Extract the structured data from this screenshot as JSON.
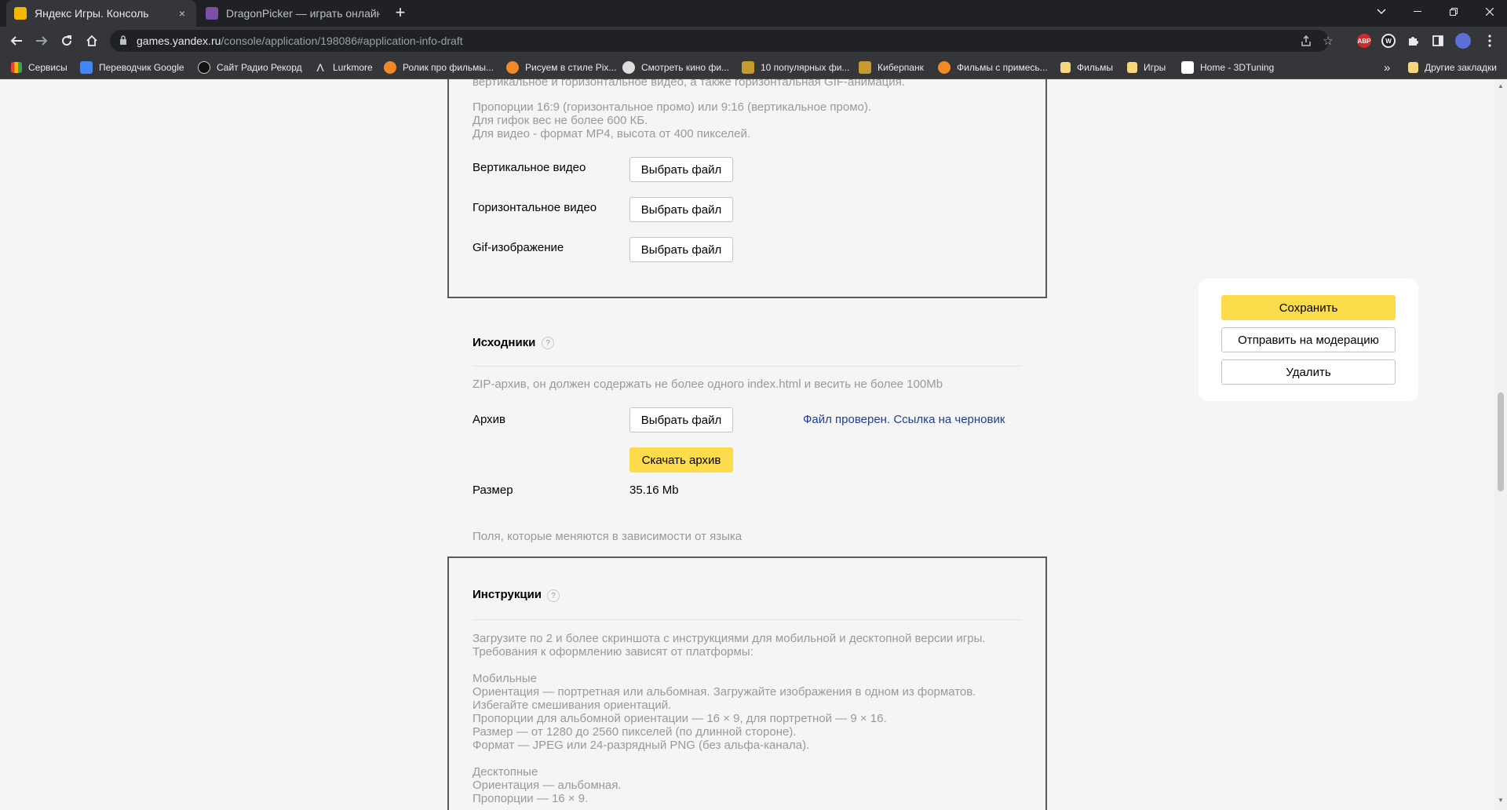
{
  "browser": {
    "tabs": [
      {
        "title": "Яндекс Игры. Консоль",
        "close": "×"
      },
      {
        "title": "DragonPicker — играть онлайн"
      }
    ],
    "new_tab": "+",
    "url_host": "games.yandex.ru",
    "url_path": "/console/application/198086#application-info-draft",
    "extensions": [
      "ABP",
      "W"
    ],
    "bookmarks": [
      "Сервисы",
      "Переводчик Google",
      "Сайт Радио Рекорд",
      "Lurkmore",
      "Ролик про фильмы...",
      "Рисуем в стиле Pix...",
      "Смотреть кино фи...",
      "10 популярных фи...",
      "Киберпанк",
      "Фильмы с примесь...",
      "Фильмы",
      "Игры",
      "Home - 3DTuning"
    ],
    "bookmarks_more": "»",
    "other_bookmarks": "Другие закладки"
  },
  "promo": {
    "cut_line": "вертикальное и горизонтальное видео, а также горизонтальная GIF-анимация.",
    "req1": "Пропорции 16:9 (горизонтальное промо) или 9:16 (вертикальное промо).",
    "req2": "Для гифок вес не более 600 КБ.",
    "req3": "Для видео - формат MP4, высота от 400 пикселей.",
    "vertical_video_label": "Вертикальное видео",
    "horizontal_video_label": "Горизонтальное видео",
    "gif_label": "Gif-изображение",
    "choose_file": "Выбрать файл"
  },
  "sources": {
    "title": "Исходники",
    "help": "?",
    "description": "ZIP-архив, он должен содержать не более одного index.html и весить не более 100Mb",
    "archive_label": "Архив",
    "choose_file": "Выбрать файл",
    "status_text": "Файл проверен.",
    "draft_link": "Ссылка на черновик",
    "download_button": "Скачать архив",
    "size_label": "Размер",
    "size_value": "35.16 Mb",
    "language_note": "Поля, которые меняются в зависимости от языка"
  },
  "instructions": {
    "title": "Инструкции",
    "help": "?",
    "intro1": "Загрузите по 2 и более скриншота с инструкциями для мобильной и десктопной версии игры.",
    "intro2": "Требования к оформлению зависят от платформы:",
    "mobile_heading": "Мобильные",
    "mobile1": "Ориентация — портретная или альбомная. Загружайте изображения в одном из форматов.",
    "mobile2": "Избегайте смешивания ориентаций.",
    "mobile3": "Пропорции для альбомной ориентации — 16 × 9, для портретной — 9 × 16.",
    "mobile4": "Размер — от 1280 до 2560 пикселей (по длинной стороне).",
    "mobile5": "Формат — JPEG или 24-разрядный PNG (без альфа-канала).",
    "desktop_heading": "Десктопные",
    "desktop1": "Ориентация — альбомная.",
    "desktop2": "Пропорции — 16 × 9."
  },
  "actions": {
    "save": "Сохранить",
    "send_moderation": "Отправить на модерацию",
    "delete": "Удалить"
  }
}
